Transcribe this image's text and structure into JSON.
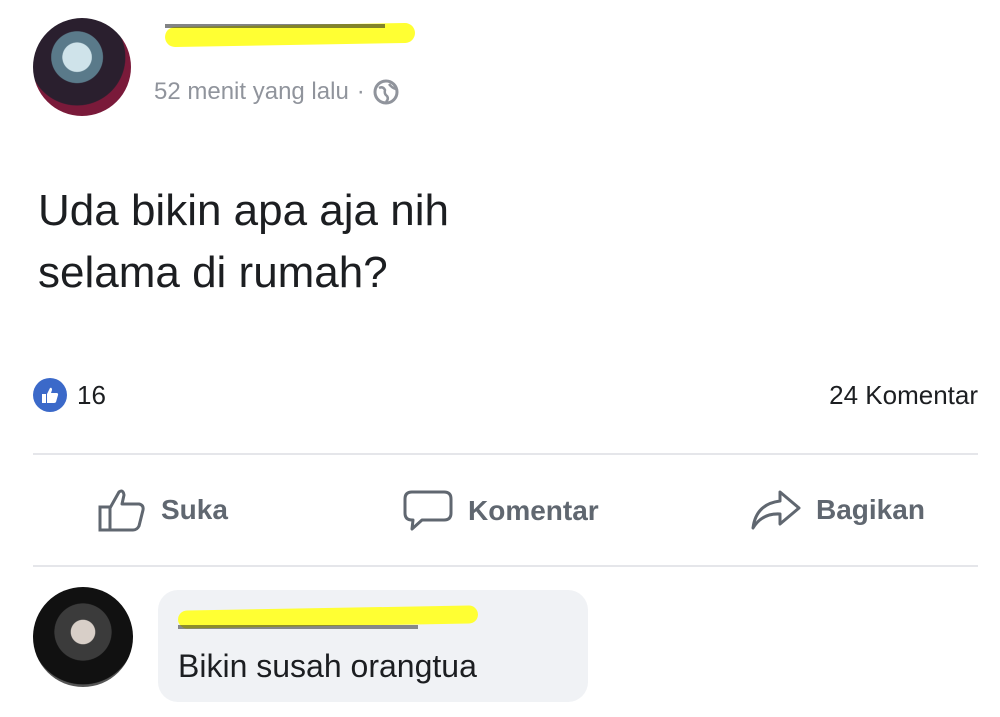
{
  "post": {
    "timestamp": "52 menit yang lalu",
    "separator": "·",
    "privacy_icon": "globe-icon",
    "text_line1": "Uda bikin apa aja nih",
    "text_line2": "selama di rumah?",
    "like_count": "16",
    "comment_count": "24 Komentar"
  },
  "actions": {
    "like_label": "Suka",
    "comment_label": "Komentar",
    "share_label": "Bagikan"
  },
  "comment": {
    "text": "Bikin susah orangtua"
  },
  "colors": {
    "accent": "#3b69c9",
    "redaction": "#ffff33",
    "muted": "#90949c"
  }
}
